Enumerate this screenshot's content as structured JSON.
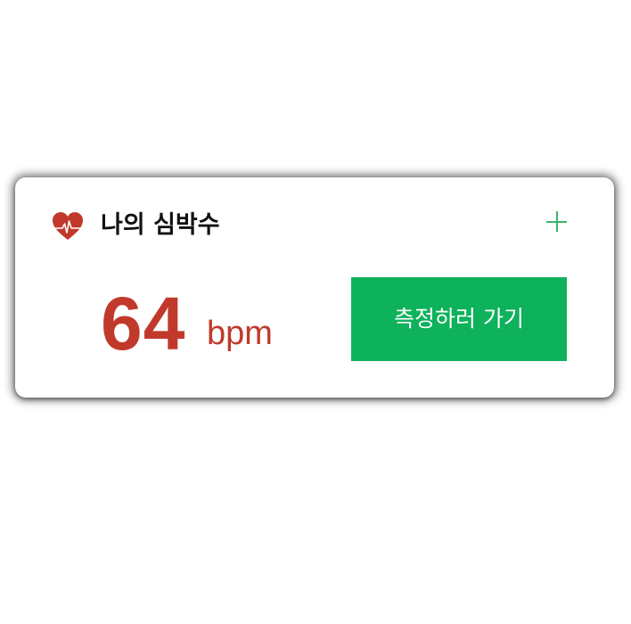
{
  "card": {
    "title": "나의 심박수",
    "icon": "heart-rate-icon",
    "add_icon": "plus-icon",
    "heart_rate": {
      "value": "64",
      "unit": "bpm"
    },
    "measure_button_label": "측정하러 가기"
  },
  "colors": {
    "heart": "#c0392b",
    "value": "#c0392b",
    "button": "#0db25a",
    "plus": "#3bb36a"
  }
}
